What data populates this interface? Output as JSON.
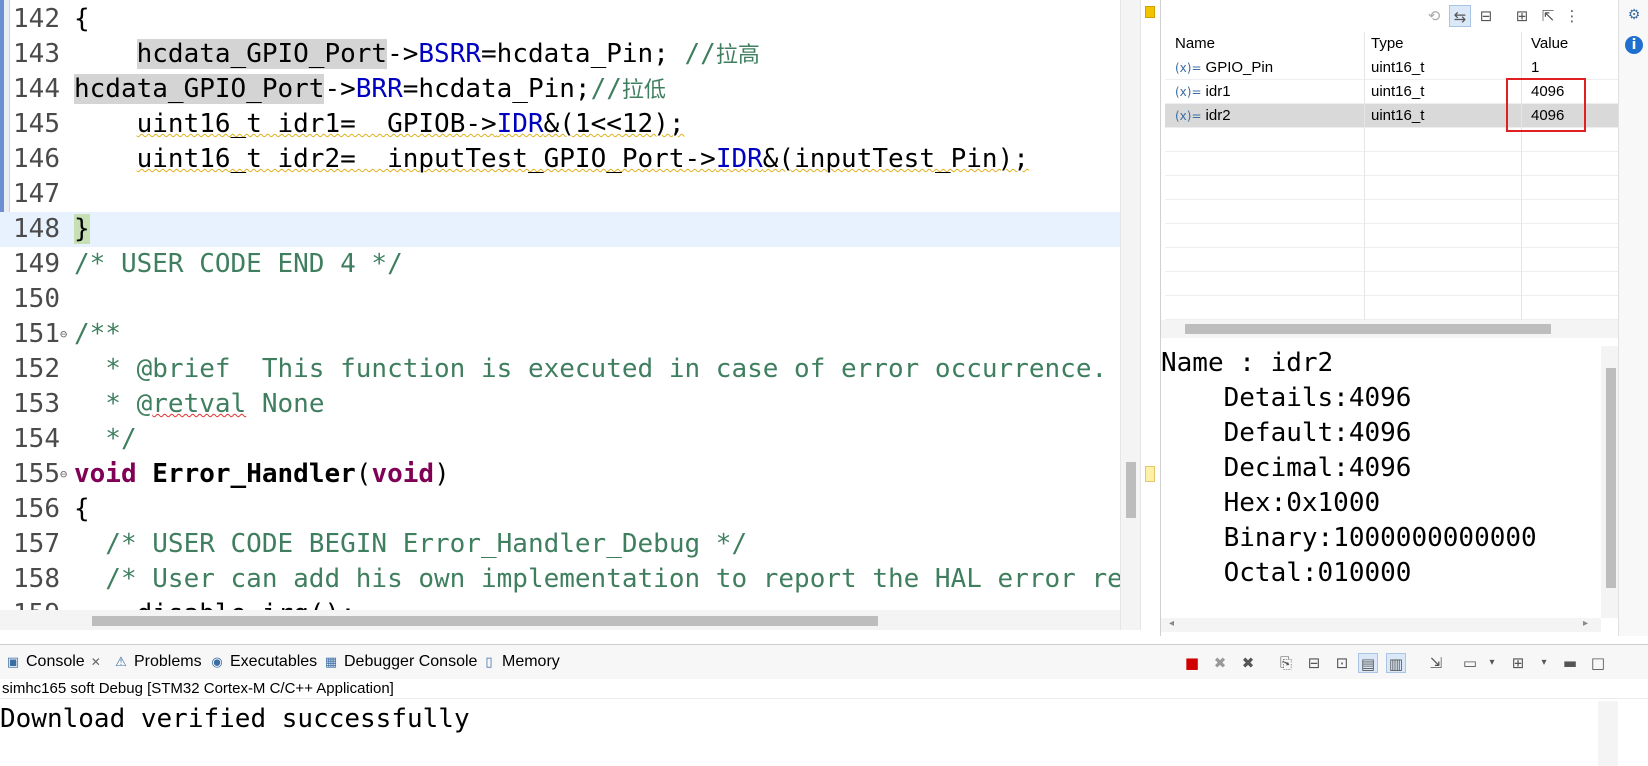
{
  "editor": {
    "lines": [
      {
        "ln": "142",
        "parts": [
          {
            "t": "{",
            "c": ""
          }
        ]
      },
      {
        "ln": "143",
        "parts": [
          {
            "t": "    ",
            "c": ""
          },
          {
            "t": "hcdata_GPIO_Port",
            "c": "hl"
          },
          {
            "t": "->",
            "c": ""
          },
          {
            "t": "BSRR",
            "c": "field"
          },
          {
            "t": "=hcdata_Pin; ",
            "c": ""
          },
          {
            "t": "//",
            "c": "comment"
          },
          {
            "t": "拉高",
            "c": "comment cjk"
          }
        ]
      },
      {
        "ln": "144",
        "parts": [
          {
            "t": "hcdata_GPIO_Port",
            "c": "hl"
          },
          {
            "t": "->",
            "c": ""
          },
          {
            "t": "BRR",
            "c": "field"
          },
          {
            "t": "=hcdata_Pin;",
            "c": ""
          },
          {
            "t": "//",
            "c": "comment"
          },
          {
            "t": "拉低",
            "c": "comment cjk"
          }
        ]
      },
      {
        "ln": "145",
        "parts": [
          {
            "t": "    ",
            "c": ""
          },
          {
            "t": "uint16_t idr1=  GPIOB->",
            "c": "squiggle"
          },
          {
            "t": "IDR",
            "c": "field squiggle"
          },
          {
            "t": "&(1<<12);",
            "c": "squiggle"
          }
        ]
      },
      {
        "ln": "146",
        "parts": [
          {
            "t": "    ",
            "c": ""
          },
          {
            "t": "uint16_t idr2=  inputTest_GPIO_Port->",
            "c": "squiggle"
          },
          {
            "t": "IDR",
            "c": "field squiggle"
          },
          {
            "t": "&(inputTest_Pin);",
            "c": "squiggle"
          }
        ]
      },
      {
        "ln": "147",
        "parts": [
          {
            "t": "",
            "c": ""
          }
        ]
      },
      {
        "ln": "148",
        "current": true,
        "parts": [
          {
            "t": "}",
            "c": "bracehl"
          }
        ]
      },
      {
        "ln": "149",
        "parts": [
          {
            "t": "/* USER CODE END 4 */",
            "c": "comment"
          }
        ]
      },
      {
        "ln": "150",
        "parts": [
          {
            "t": "",
            "c": ""
          }
        ]
      },
      {
        "ln": "151",
        "fold": "⊖",
        "parts": [
          {
            "t": "/**",
            "c": "comment"
          }
        ]
      },
      {
        "ln": "152",
        "parts": [
          {
            "t": "  * @brief  This function is executed in case of error occurrence.",
            "c": "comment"
          }
        ]
      },
      {
        "ln": "153",
        "parts": [
          {
            "t": "  * @",
            "c": "comment"
          },
          {
            "t": "retval",
            "c": "comment squiggle-red"
          },
          {
            "t": " None",
            "c": "comment"
          }
        ]
      },
      {
        "ln": "154",
        "parts": [
          {
            "t": "  */",
            "c": "comment"
          }
        ]
      },
      {
        "ln": "155",
        "fold": "⊖",
        "parts": [
          {
            "t": "void",
            "c": "kw"
          },
          {
            "t": " ",
            "c": ""
          },
          {
            "t": "Error_Handler",
            "c": "fn"
          },
          {
            "t": "(",
            "c": ""
          },
          {
            "t": "void",
            "c": "kw"
          },
          {
            "t": ")",
            "c": ""
          }
        ]
      },
      {
        "ln": "156",
        "parts": [
          {
            "t": "{",
            "c": ""
          }
        ]
      },
      {
        "ln": "157",
        "parts": [
          {
            "t": "  /* USER CODE BEGIN Error_Handler_Debug */",
            "c": "comment"
          }
        ]
      },
      {
        "ln": "158",
        "parts": [
          {
            "t": "  /* User can add his own implementation to report the HAL error return state */",
            "c": "comment"
          }
        ]
      },
      {
        "ln": "159",
        "parts": [
          {
            "t": "  __disable_irq();",
            "c": ""
          }
        ]
      }
    ]
  },
  "variables": {
    "headers": {
      "name": "Name",
      "type": "Type",
      "value": "Value"
    },
    "icon_label": "(x)=",
    "rows": [
      {
        "name": "GPIO_Pin",
        "type": "uint16_t",
        "value": "1"
      },
      {
        "name": "idr1",
        "type": "uint16_t",
        "value": "4096"
      },
      {
        "name": "idr2",
        "type": "uint16_t",
        "value": "4096",
        "selected": true
      }
    ],
    "details": [
      "Name : idr2",
      "    Details:4096",
      "    Default:4096",
      "    Decimal:4096",
      "    Hex:0x1000",
      "    Binary:1000000000000",
      "    Octal:010000"
    ]
  },
  "console": {
    "tabs": [
      {
        "label": "Console",
        "icon": "console-icon",
        "closable": true
      },
      {
        "label": "Problems",
        "icon": "problems-icon"
      },
      {
        "label": "Executables",
        "icon": "executables-icon"
      },
      {
        "label": "Debugger Console",
        "icon": "debugger-console-icon"
      },
      {
        "label": "Memory",
        "icon": "memory-icon"
      }
    ],
    "launch": "simhc165 soft Debug [STM32 Cortex-M C/C++ Application]",
    "output": "Download verified successfully"
  },
  "colors": {
    "accent": "#0000c0",
    "comment": "#3f7f5f",
    "keyword": "#7f0055",
    "highlight_box": "#e02020"
  }
}
